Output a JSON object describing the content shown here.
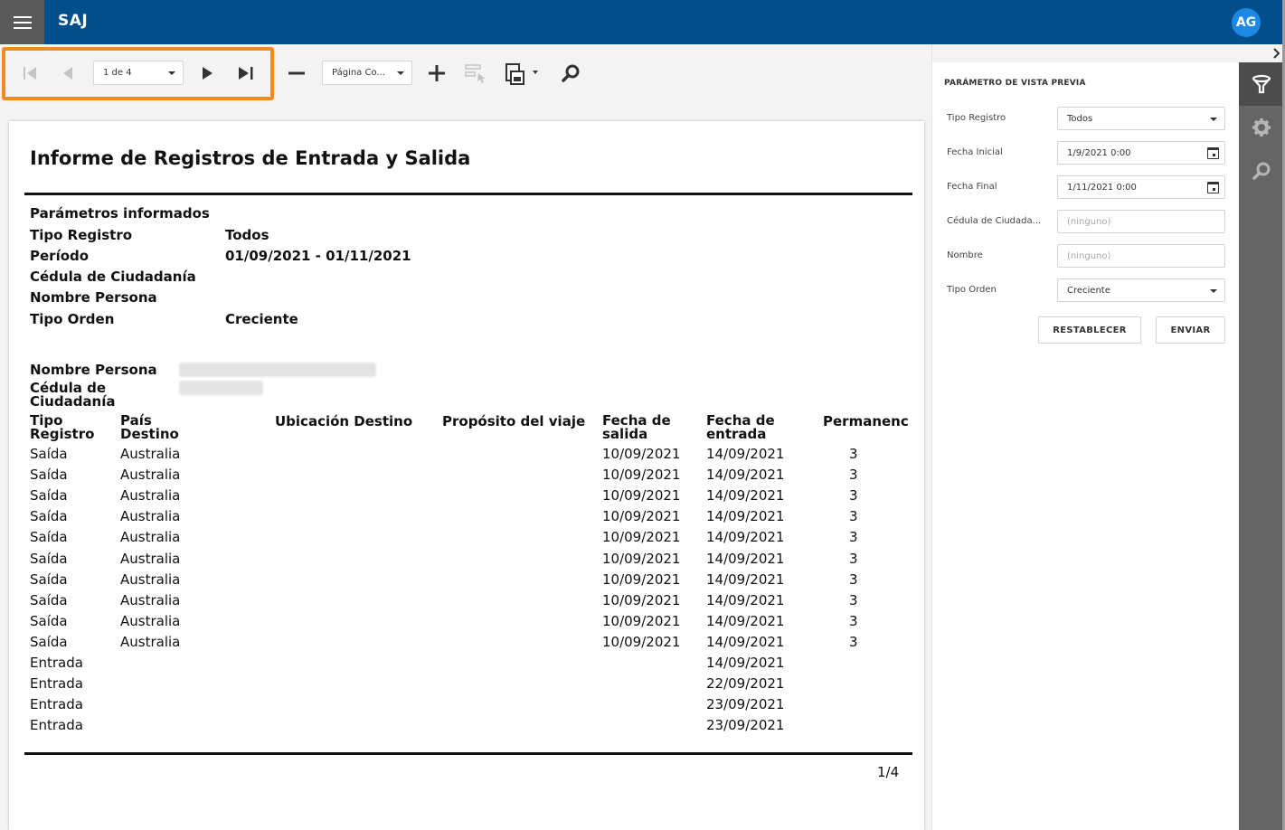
{
  "app": {
    "title": "SAJ",
    "user_initials": "AG"
  },
  "toolbar": {
    "page_selector": "1 de 4",
    "zoom_selector": "Página Co..."
  },
  "report": {
    "title": "Informe de Registros de Entrada y Salida",
    "params_heading": "Parámetros informados",
    "params": [
      {
        "label": "Tipo Registro",
        "value": "Todos"
      },
      {
        "label": "Período",
        "value": "01/09/2021 - 01/11/2021"
      },
      {
        "label": "Cédula de Ciudadanía",
        "value": ""
      },
      {
        "label": "Nombre Persona",
        "value": ""
      },
      {
        "label": "Tipo Orden",
        "value": "Creciente"
      }
    ],
    "person_name_label": "Nombre Persona",
    "cedula_label_line1": "Cédula de",
    "cedula_label_line2": "Ciudadanía",
    "columns": {
      "tipo_l1": "Tipo",
      "tipo_l2": "Registro",
      "pais_l1": "País",
      "pais_l2": "Destino",
      "ubicacion": "Ubicación Destino",
      "proposito": "Propósito del viaje",
      "salida_l1": "Fecha de",
      "salida_l2": "salida",
      "entrada_l1": "Fecha de",
      "entrada_l2": "entrada",
      "permanencia": "Permanenc"
    },
    "rows": [
      {
        "tipo": "Saída",
        "pais": "Australia",
        "salida": "10/09/2021",
        "entrada": "14/09/2021",
        "perm": "3"
      },
      {
        "tipo": "Saída",
        "pais": "Australia",
        "salida": "10/09/2021",
        "entrada": "14/09/2021",
        "perm": "3"
      },
      {
        "tipo": "Saída",
        "pais": "Australia",
        "salida": "10/09/2021",
        "entrada": "14/09/2021",
        "perm": "3"
      },
      {
        "tipo": "Saída",
        "pais": "Australia",
        "salida": "10/09/2021",
        "entrada": "14/09/2021",
        "perm": "3"
      },
      {
        "tipo": "Saída",
        "pais": "Australia",
        "salida": "10/09/2021",
        "entrada": "14/09/2021",
        "perm": "3"
      },
      {
        "tipo": "Saída",
        "pais": "Australia",
        "salida": "10/09/2021",
        "entrada": "14/09/2021",
        "perm": "3"
      },
      {
        "tipo": "Saída",
        "pais": "Australia",
        "salida": "10/09/2021",
        "entrada": "14/09/2021",
        "perm": "3"
      },
      {
        "tipo": "Saída",
        "pais": "Australia",
        "salida": "10/09/2021",
        "entrada": "14/09/2021",
        "perm": "3"
      },
      {
        "tipo": "Saída",
        "pais": "Australia",
        "salida": "10/09/2021",
        "entrada": "14/09/2021",
        "perm": "3"
      },
      {
        "tipo": "Saída",
        "pais": "Australia",
        "salida": "10/09/2021",
        "entrada": "14/09/2021",
        "perm": "3"
      },
      {
        "tipo": "Entrada",
        "pais": "",
        "salida": "",
        "entrada": "14/09/2021",
        "perm": ""
      },
      {
        "tipo": "Entrada",
        "pais": "",
        "salida": "",
        "entrada": "22/09/2021",
        "perm": ""
      },
      {
        "tipo": "Entrada",
        "pais": "",
        "salida": "",
        "entrada": "23/09/2021",
        "perm": ""
      },
      {
        "tipo": "Entrada",
        "pais": "",
        "salida": "",
        "entrada": "23/09/2021",
        "perm": ""
      }
    ],
    "page_footer": "1/4"
  },
  "panel": {
    "title": "PARÁMETRO DE VISTA PREVIA",
    "fields": [
      {
        "label": "Tipo Registro",
        "value": "Todos",
        "kind": "select"
      },
      {
        "label": "Fecha Inicial",
        "value": "1/9/2021 0:00",
        "kind": "date"
      },
      {
        "label": "Fecha Final",
        "value": "1/11/2021 0:00",
        "kind": "date"
      },
      {
        "label": "Cédula de Ciudada...",
        "placeholder": "(ninguno)",
        "kind": "text"
      },
      {
        "label": "Nombre",
        "placeholder": "(ninguno)",
        "kind": "text"
      },
      {
        "label": "Tipo Orden",
        "value": "Creciente",
        "kind": "select"
      }
    ],
    "reset_label": "RESTABLECER",
    "submit_label": "ENVIAR"
  },
  "colors": {
    "topbar": "#004f8c",
    "highlight": "#f28a22",
    "rail": "#656565",
    "avatar": "#1e88e5"
  }
}
